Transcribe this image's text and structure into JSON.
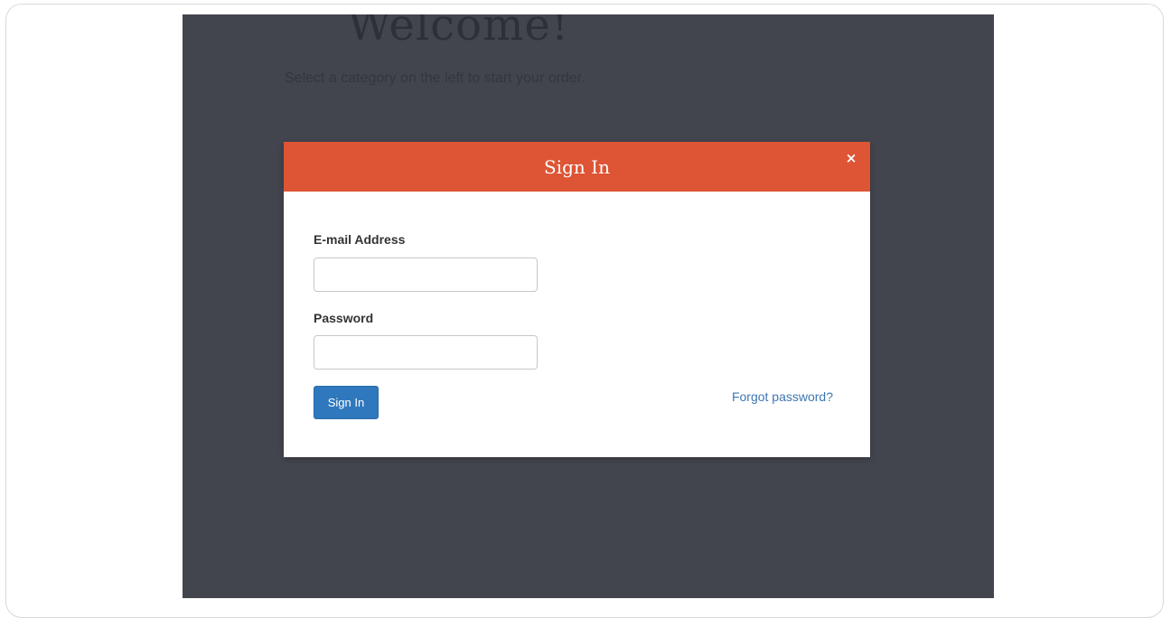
{
  "background_page": {
    "title": "Welcome!",
    "subtitle": "Select a category on the left to start your order."
  },
  "modal": {
    "title": "Sign In",
    "close_icon": "close-icon",
    "close_glyph": "×",
    "email": {
      "label": "E-mail Address",
      "value": "",
      "placeholder": ""
    },
    "password": {
      "label": "Password",
      "value": "",
      "placeholder": ""
    },
    "submit_label": "Sign In",
    "forgot_label": "Forgot password?"
  },
  "colors": {
    "backdrop": "#43454e",
    "header": "#dd5535",
    "primary_button": "#2f78bd",
    "link": "#3d77b3"
  }
}
